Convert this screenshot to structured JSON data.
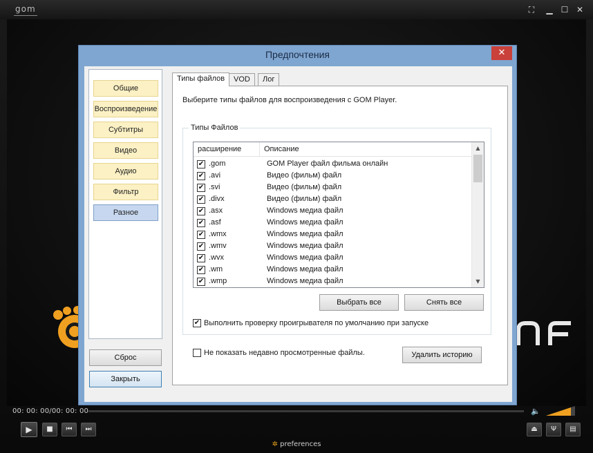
{
  "player": {
    "logo": "GOM",
    "time": "00: 00: 00/00: 00: 00",
    "bottom_label": "preferences",
    "window_buttons": [
      "fullscreen-icon",
      "minimize-icon",
      "maximize-icon",
      "close-icon"
    ],
    "controls": [
      "play-icon",
      "stop-icon",
      "prev-icon",
      "next-icon"
    ],
    "right_controls": [
      "eject-icon",
      "equalizer-icon",
      "playlist-icon"
    ],
    "accent": "#f0a020",
    "background_text": "ɪɴғ"
  },
  "dialog": {
    "title": "Предпочтения",
    "close_symbol": "✕",
    "nav": [
      {
        "label": "Общие"
      },
      {
        "label": "Воспроизведение"
      },
      {
        "label": "Субтитры"
      },
      {
        "label": "Видео"
      },
      {
        "label": "Аудио"
      },
      {
        "label": "Фильтр"
      },
      {
        "label": "Разное",
        "selected": true
      }
    ],
    "reset_label": "Сброс",
    "close_label": "Закрыть",
    "tabs": [
      {
        "label": "Типы файлов",
        "active": true
      },
      {
        "label": "VOD"
      },
      {
        "label": "Лог"
      }
    ],
    "intro": "Выберите типы файлов для воспроизведения с GOM Player.",
    "group_title": "Типы Файлов",
    "columns": {
      "ext": "расширение",
      "desc": "Описание"
    },
    "rows": [
      {
        "ext": ".gom",
        "desc": "GOM Player файл фильма онлайн",
        "checked": true
      },
      {
        "ext": ".avi",
        "desc": "Видео (фильм) файл",
        "checked": true
      },
      {
        "ext": ".svi",
        "desc": "Видео (фильм) файл",
        "checked": true
      },
      {
        "ext": ".divx",
        "desc": "Видео (фильм) файл",
        "checked": true
      },
      {
        "ext": ".asx",
        "desc": "Windows медиа файл",
        "checked": true
      },
      {
        "ext": ".asf",
        "desc": "Windows медиа файл",
        "checked": true
      },
      {
        "ext": ".wmx",
        "desc": "Windows медиа файл",
        "checked": true
      },
      {
        "ext": ".wmv",
        "desc": "Windows медиа файл",
        "checked": true
      },
      {
        "ext": ".wvx",
        "desc": "Windows медиа файл",
        "checked": true
      },
      {
        "ext": ".wm",
        "desc": "Windows медиа файл",
        "checked": true
      },
      {
        "ext": ".wmp",
        "desc": "Windows медиа файл",
        "checked": true
      }
    ],
    "select_all": "Выбрать все",
    "deselect_all": "Снять все",
    "default_check_label": "Выполнить проверку проигрывателя по умолчанию при запуске",
    "default_check_checked": true,
    "hide_recent_label": "Не показать недавно просмотренные файлы.",
    "hide_recent_checked": false,
    "delete_history": "Удалить историю",
    "check_mark": "✔"
  }
}
